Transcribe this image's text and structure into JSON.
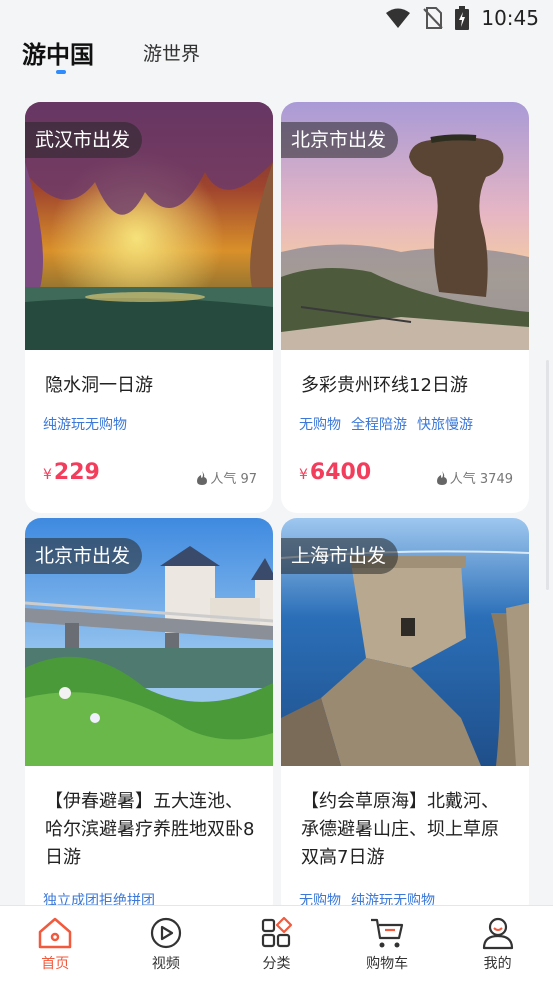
{
  "status_bar": {
    "time": "10:45"
  },
  "tabs": {
    "active": "游中国",
    "other": "游世界"
  },
  "cards": [
    {
      "badge": "武汉市出发",
      "title": "隐水洞一日游",
      "tags": [
        "纯游玩无购物"
      ],
      "price_symbol": "¥",
      "price": "229",
      "popularity": "人气 97"
    },
    {
      "badge": "北京市出发",
      "title": "多彩贵州环线12日游",
      "tags": [
        "无购物",
        "全程陪游",
        "快旅慢游"
      ],
      "price_symbol": "¥",
      "price": "6400",
      "popularity": "人气 3749"
    },
    {
      "badge": "北京市出发",
      "title": "【伊春避暑】五大连池、哈尔滨避暑疗养胜地双卧8日游",
      "tags": [
        "独立成团拒绝拼团"
      ]
    },
    {
      "badge": "上海市出发",
      "title": "【约会草原海】北戴河、承德避暑山庄、坝上草原双高7日游",
      "tags": [
        "无购物",
        "纯游玩无购物"
      ]
    }
  ],
  "bottom_nav": [
    {
      "label": "首页",
      "icon": "home-icon",
      "active": true
    },
    {
      "label": "视频",
      "icon": "play-icon",
      "active": false
    },
    {
      "label": "分类",
      "icon": "category-icon",
      "active": false
    },
    {
      "label": "购物车",
      "icon": "cart-icon",
      "active": false
    },
    {
      "label": "我的",
      "icon": "profile-icon",
      "active": false
    }
  ],
  "colors": {
    "accent": "#f25a3d",
    "price": "#f23d5c",
    "tag": "#3b78d8",
    "tab_indicator": "#2f8cff"
  }
}
